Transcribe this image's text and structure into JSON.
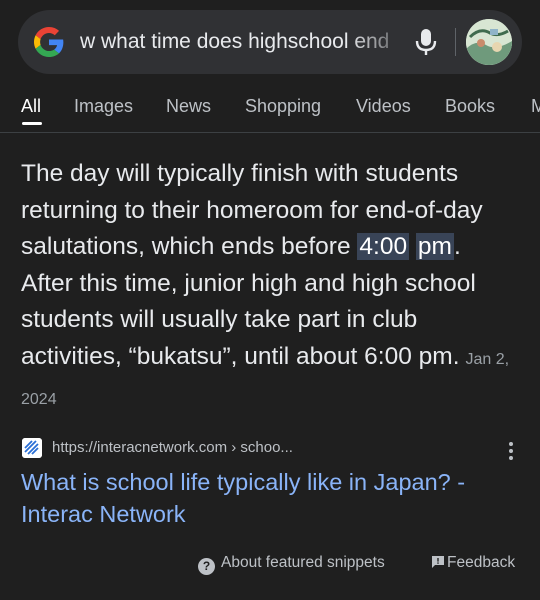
{
  "search": {
    "query": "w what time does highschool end"
  },
  "tabs": [
    {
      "label": "All",
      "active": true
    },
    {
      "label": "Images"
    },
    {
      "label": "News"
    },
    {
      "label": "Shopping"
    },
    {
      "label": "Videos"
    },
    {
      "label": "Books"
    },
    {
      "label": "M"
    }
  ],
  "snippet": {
    "part1": "The day will typically finish with students returning to their homeroom for end-of-day salutations, which ends before ",
    "highlight_a": "4:00",
    "highlight_b": "pm",
    "part2": ". After this time, junior high and high school students will usually take part in club activities, “bukatsu”, until about 6:00 pm.",
    "date": "Jan 2, 2024"
  },
  "source": {
    "url": "https://interacnetwork.com › schoo...",
    "title": "What is school life typically like in Japan? - Interac Network"
  },
  "footer": {
    "about_label": "About featured snippets",
    "feedback_label": "Feedback"
  },
  "icons": {
    "google_logo": "google-g-logo",
    "mic": "mic-icon",
    "avatar": "profile-avatar",
    "favicon": "interac-favicon",
    "more": "more-vert-icon",
    "about": "question-icon",
    "feedback": "feedback-icon"
  }
}
